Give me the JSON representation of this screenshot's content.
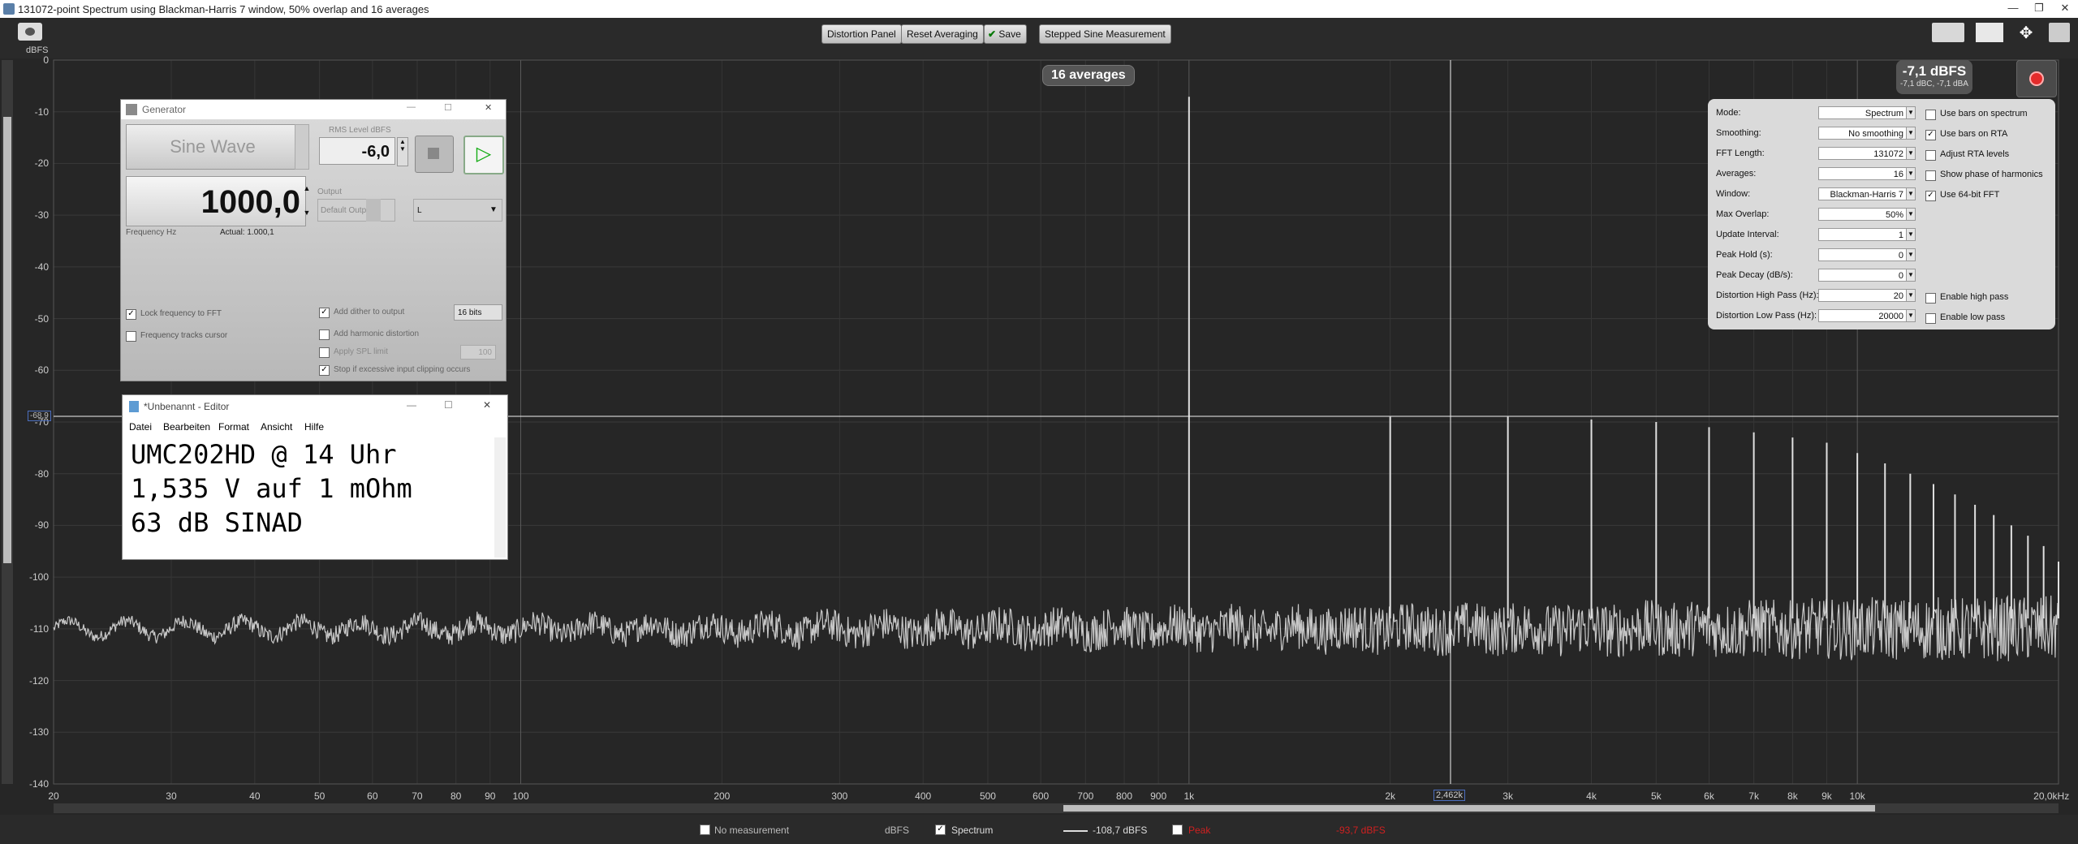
{
  "window": {
    "title": "131072-point Spectrum using Blackman-Harris 7 window, 50% overlap and 16 averages",
    "controls": [
      "—",
      "❐",
      "✕"
    ]
  },
  "toolbar": {
    "distortion_panel": "Distortion Panel",
    "reset_averaging": "Reset Averaging",
    "save": "Save",
    "stepped_sine": "Stepped Sine Measurement"
  },
  "chart_data": {
    "type": "line",
    "title": "",
    "ylabel": "dBFS",
    "xlabel": "",
    "xscale": "log",
    "xlim": [
      20,
      20000
    ],
    "ylim": [
      -140,
      0
    ],
    "grid": true,
    "y_ticks": [
      "0",
      "-10",
      "-20",
      "-30",
      "-40",
      "-50",
      "-60",
      "-70",
      "-80",
      "-90",
      "-100",
      "-110",
      "-120",
      "-130",
      "-140"
    ],
    "x_ticks": [
      {
        "v": 20,
        "t": "20"
      },
      {
        "v": 30,
        "t": "30"
      },
      {
        "v": 40,
        "t": "40"
      },
      {
        "v": 50,
        "t": "50"
      },
      {
        "v": 60,
        "t": "60"
      },
      {
        "v": 70,
        "t": "70"
      },
      {
        "v": 80,
        "t": "80"
      },
      {
        "v": 90,
        "t": "90"
      },
      {
        "v": 100,
        "t": "100"
      },
      {
        "v": 200,
        "t": "200"
      },
      {
        "v": 300,
        "t": "300"
      },
      {
        "v": 400,
        "t": "400"
      },
      {
        "v": 500,
        "t": "500"
      },
      {
        "v": 600,
        "t": "600"
      },
      {
        "v": 700,
        "t": "700"
      },
      {
        "v": 800,
        "t": "800"
      },
      {
        "v": 900,
        "t": "900"
      },
      {
        "v": 1000,
        "t": "1k"
      },
      {
        "v": 2000,
        "t": "2k"
      },
      {
        "v": 3000,
        "t": "3k"
      },
      {
        "v": 4000,
        "t": "4k"
      },
      {
        "v": 5000,
        "t": "5k"
      },
      {
        "v": 6000,
        "t": "6k"
      },
      {
        "v": 7000,
        "t": "7k"
      },
      {
        "v": 8000,
        "t": "8k"
      },
      {
        "v": 9000,
        "t": "9k"
      },
      {
        "v": 10000,
        "t": "10k"
      },
      {
        "v": 20000,
        "t": "20,0kHz"
      }
    ],
    "noise_floor_db": -110,
    "series": [
      {
        "name": "Spectrum",
        "color": "#c8c8c8",
        "peaks": [
          {
            "x": 1000,
            "y": -7.1
          },
          {
            "x": 2000,
            "y": -69
          },
          {
            "x": 3000,
            "y": -69
          },
          {
            "x": 4000,
            "y": -69.5
          },
          {
            "x": 5000,
            "y": -70
          },
          {
            "x": 6000,
            "y": -71
          },
          {
            "x": 7000,
            "y": -72
          },
          {
            "x": 8000,
            "y": -73
          },
          {
            "x": 9000,
            "y": -74
          },
          {
            "x": 10000,
            "y": -76
          },
          {
            "x": 11000,
            "y": -78
          },
          {
            "x": 12000,
            "y": -80
          },
          {
            "x": 13000,
            "y": -82
          },
          {
            "x": 14000,
            "y": -84
          },
          {
            "x": 15000,
            "y": -86
          },
          {
            "x": 16000,
            "y": -88
          },
          {
            "x": 17000,
            "y": -90
          },
          {
            "x": 18000,
            "y": -92
          },
          {
            "x": 19000,
            "y": -94
          },
          {
            "x": 20000,
            "y": -97
          }
        ]
      }
    ],
    "cursor": {
      "x_label": "2,462k",
      "y_label": "-68,9"
    }
  },
  "badge": {
    "averages": "16 averages"
  },
  "level": {
    "main": "-7,1 dBFS",
    "sub": "-7,1 dBC, -7,1 dBA"
  },
  "settings": {
    "rows": [
      {
        "label": "Mode:",
        "value": "Spectrum"
      },
      {
        "label": "Smoothing:",
        "value": "No smoothing"
      },
      {
        "label": "FFT Length:",
        "value": "131072"
      },
      {
        "label": "Averages:",
        "value": "16"
      },
      {
        "label": "Window:",
        "value": "Blackman-Harris 7"
      },
      {
        "label": "Max Overlap:",
        "value": "50%"
      },
      {
        "label": "Update Interval:",
        "value": "1"
      },
      {
        "label": "Peak Hold (s):",
        "value": "0"
      },
      {
        "label": "Peak Decay (dB/s):",
        "value": "0"
      },
      {
        "label": "Distortion High Pass (Hz):",
        "value": "20"
      },
      {
        "label": "Distortion Low Pass (Hz):",
        "value": "20000"
      }
    ],
    "checks": [
      {
        "label": "Use bars on spectrum",
        "checked": false
      },
      {
        "label": "Use bars on RTA",
        "checked": true
      },
      {
        "label": "Adjust RTA levels",
        "checked": false
      },
      {
        "label": "Show phase of harmonics",
        "checked": false
      },
      {
        "label": "Use 64-bit FFT",
        "checked": true
      }
    ],
    "enable_high_pass": "Enable high pass",
    "enable_low_pass": "Enable low pass"
  },
  "generator": {
    "title": "Generator",
    "wave": "Sine Wave",
    "rms_label": "RMS Level dBFS",
    "rms_value": "-6,0",
    "frequency": "1000,0",
    "frequency_label": "Frequency Hz",
    "actual": "Actual: 1.000,1",
    "output_label": "Output",
    "output_device": "Default Output",
    "channel": "L",
    "lock_freq": "Lock frequency to FFT",
    "freq_tracks": "Frequency tracks cursor",
    "add_dither": "Add dither to output",
    "bits": "16 bits",
    "add_harmonic": "Add harmonic distortion",
    "apply_spl": "Apply SPL limit",
    "spl_value": "100",
    "stop_clipping": "Stop if excessive input clipping occurs"
  },
  "editor": {
    "title": "*Unbenannt - Editor",
    "menu": [
      "Datei",
      "Bearbeiten",
      "Format",
      "Ansicht",
      "Hilfe"
    ],
    "lines": [
      "UMC202HD @ 14 Uhr",
      "1,535 V auf 1 mOhm",
      "63 dB SINAD"
    ]
  },
  "bottom": {
    "no_measurement": "No measurement",
    "dbfs": "dBFS",
    "spectrum": "Spectrum",
    "spectrum_value": "-108,7 dBFS",
    "peak": "Peak",
    "peak_value": "-93,7 dBFS"
  },
  "colors": {
    "background": "#262626",
    "trace": "#c8c8c8",
    "grid": "#3c3c3c",
    "accent_record": "#e42b2b",
    "peak_red": "#d02020"
  }
}
